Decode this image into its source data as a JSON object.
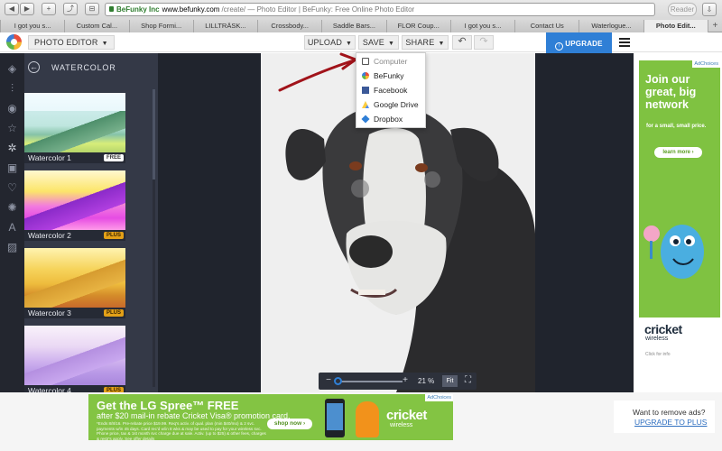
{
  "browser": {
    "nav": {
      "back": "◀",
      "forward": "▶",
      "add": "+",
      "share": "⤴",
      "bookmarks": "⊟"
    },
    "secure_label": "BeFunky Inc",
    "url_host": "www.befunky.com",
    "url_path": "/create/",
    "page_title": " — Photo Editor | BeFunky: Free Online Photo Editor",
    "reader_label": "Reader",
    "tabs": [
      "I got you s...",
      "Custom Cal...",
      "Shop Formi...",
      "LILLTRÄSK...",
      "Crossbody...",
      "Saddle Bars...",
      "FLOR Coup...",
      "I got you s...",
      "Contact Us",
      "Waterlogue...",
      "Photo Edit..."
    ],
    "active_tab": 10
  },
  "appbar": {
    "editor_label": "PHOTO EDITOR",
    "upload_label": "UPLOAD",
    "save_label": "SAVE",
    "share_label": "SHARE",
    "undo": "↶",
    "redo": "↷",
    "upgrade_label": "UPGRADE NOW"
  },
  "rail": {
    "icons": [
      "layers-icon",
      "sliders-icon",
      "eye-icon",
      "star-icon",
      "gear-icon",
      "frame-icon",
      "heart-icon",
      "circle-icon",
      "text-icon",
      "texture-icon"
    ]
  },
  "panel": {
    "title": "WATERCOLOR",
    "back": "←",
    "items": [
      {
        "label": "Watercolor 1",
        "badge": "FREE"
      },
      {
        "label": "Watercolor 2",
        "badge": "PLUS"
      },
      {
        "label": "Watercolor 3",
        "badge": "PLUS"
      },
      {
        "label": "Watercolor 4",
        "badge": "PLUS"
      }
    ]
  },
  "zoom": {
    "minus": "−",
    "plus": "+",
    "value": "21 %",
    "fit_label": "Fit",
    "fullscreen": "⛶"
  },
  "save_menu": {
    "items": [
      "Computer",
      "BeFunky",
      "Facebook",
      "Google Drive",
      "Dropbox"
    ]
  },
  "ad_right": {
    "choices": "AdChoices",
    "headline": "Join our great, big network",
    "sub": "for a small, small price.",
    "button": "learn more ›",
    "brand": "cricket",
    "brand_sub": "wireless",
    "click_info": "Click for info"
  },
  "ad_bottom": {
    "choices": "AdChoices",
    "title": "Get the LG Spree™ FREE",
    "sub": "after $20 mail-in rebate Cricket Visa® promotion card.",
    "fine": "*Ends 8/8/16. Pre-rebate price $19.99. Req's activ. of qual. plan (min $40/mo) & 2 svc. payments w/in 45 days. Card rec'd w/in 8 wks & may be used to pay for your wireless svc. Phone price, tax & 1st month svc charge due at sale. Activ. (up to $25) & other fees, charges & restr's apply. See offer details",
    "button": "shop now ›",
    "brand": "cricket",
    "brand_sub": "wireless"
  },
  "remove_ads": {
    "question": "Want to remove ads?",
    "link": "UPGRADE TO PLUS"
  },
  "colors": {
    "accent": "#2f7fd6",
    "panel": "#343947",
    "rail": "#23262f",
    "canvas": "#20242d",
    "plus_badge": "#e3a017",
    "ad_green": "#7fc241"
  }
}
